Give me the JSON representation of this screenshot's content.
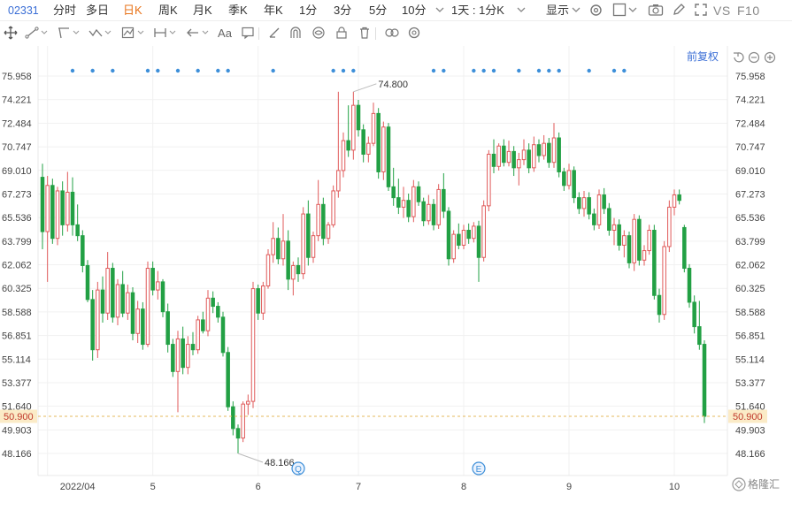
{
  "toolbar": {
    "code": "02331",
    "periods": [
      "分时",
      "多日",
      "日K",
      "周K",
      "月K",
      "季K",
      "年K",
      "1分",
      "3分",
      "5分",
      "10分"
    ],
    "active_period": "日K",
    "multi_period": "1天 : 1分K",
    "display_label": "显示",
    "vs_label": "VS",
    "f10_label": "F10"
  },
  "toolbar2": {
    "text_tool_label": "Aa"
  },
  "chart": {
    "adjust_label": "前复权",
    "high_label": "74.800",
    "low_label": "48.166",
    "current_price_label": "50.900",
    "marker_q": "Q",
    "marker_e": "E",
    "watermark": "格隆汇"
  },
  "chart_data": {
    "type": "candlestick",
    "ylim": [
      47.0,
      76.8
    ],
    "yticks": [
      "75.958",
      "74.221",
      "72.484",
      "70.747",
      "69.010",
      "67.273",
      "65.536",
      "63.799",
      "62.062",
      "60.325",
      "58.588",
      "56.851",
      "55.114",
      "53.377",
      "51.640",
      "49.903",
      "48.166"
    ],
    "xtick_labels": [
      "2022/04",
      "5",
      "6",
      "7",
      "8",
      "9",
      "10"
    ],
    "xtick_index": [
      1,
      22,
      43,
      63,
      84,
      105,
      126
    ],
    "current_price": 50.9,
    "max_price": 74.8,
    "max_index": 62,
    "min_price": 48.166,
    "min_index": 39,
    "dividend_dot_index": [
      6,
      10,
      14,
      21,
      23,
      27,
      31,
      35,
      37,
      46,
      58,
      60,
      62,
      78,
      80,
      86,
      88,
      90,
      95,
      99,
      101,
      103,
      109,
      114,
      116
    ],
    "event_markers": [
      {
        "label": "Q",
        "index": 51
      },
      {
        "label": "E",
        "index": 87
      }
    ],
    "candles": [
      {
        "o": 68.5,
        "h": 69.5,
        "l": 63.2,
        "c": 64.5
      },
      {
        "o": 64.5,
        "h": 68.6,
        "l": 60.8,
        "c": 67.9
      },
      {
        "o": 67.9,
        "h": 68.4,
        "l": 63.6,
        "c": 64.0
      },
      {
        "o": 64.0,
        "h": 67.8,
        "l": 63.5,
        "c": 67.5
      },
      {
        "o": 67.5,
        "h": 68.2,
        "l": 64.2,
        "c": 65.0
      },
      {
        "o": 65.0,
        "h": 68.9,
        "l": 64.5,
        "c": 67.4
      },
      {
        "o": 67.4,
        "h": 68.5,
        "l": 64.2,
        "c": 65.0
      },
      {
        "o": 65.0,
        "h": 66.5,
        "l": 63.8,
        "c": 64.2
      },
      {
        "o": 64.2,
        "h": 64.6,
        "l": 61.5,
        "c": 62.0
      },
      {
        "o": 62.0,
        "h": 62.4,
        "l": 59.3,
        "c": 59.5
      },
      {
        "o": 59.5,
        "h": 60.2,
        "l": 55.0,
        "c": 55.8
      },
      {
        "o": 55.8,
        "h": 60.8,
        "l": 55.2,
        "c": 60.2
      },
      {
        "o": 60.2,
        "h": 61.2,
        "l": 57.8,
        "c": 58.5
      },
      {
        "o": 58.5,
        "h": 63.0,
        "l": 58.0,
        "c": 61.8
      },
      {
        "o": 61.8,
        "h": 62.2,
        "l": 57.8,
        "c": 58.2
      },
      {
        "o": 58.2,
        "h": 61.0,
        "l": 57.6,
        "c": 60.6
      },
      {
        "o": 60.6,
        "h": 61.6,
        "l": 58.2,
        "c": 58.5
      },
      {
        "o": 58.5,
        "h": 60.6,
        "l": 58.0,
        "c": 60.0
      },
      {
        "o": 60.0,
        "h": 60.4,
        "l": 56.5,
        "c": 57.0
      },
      {
        "o": 57.0,
        "h": 59.4,
        "l": 56.3,
        "c": 58.8
      },
      {
        "o": 58.8,
        "h": 59.3,
        "l": 55.8,
        "c": 56.2
      },
      {
        "o": 56.2,
        "h": 62.3,
        "l": 56.0,
        "c": 61.8
      },
      {
        "o": 61.8,
        "h": 62.3,
        "l": 59.8,
        "c": 60.2
      },
      {
        "o": 60.2,
        "h": 61.6,
        "l": 59.5,
        "c": 60.8
      },
      {
        "o": 60.8,
        "h": 61.0,
        "l": 58.2,
        "c": 58.6
      },
      {
        "o": 58.6,
        "h": 59.2,
        "l": 55.6,
        "c": 56.2
      },
      {
        "o": 56.2,
        "h": 56.6,
        "l": 53.8,
        "c": 54.2
      },
      {
        "o": 54.2,
        "h": 57.2,
        "l": 51.2,
        "c": 56.6
      },
      {
        "o": 56.6,
        "h": 57.5,
        "l": 54.0,
        "c": 54.5
      },
      {
        "o": 54.5,
        "h": 56.8,
        "l": 54.0,
        "c": 56.2
      },
      {
        "o": 56.2,
        "h": 57.1,
        "l": 55.4,
        "c": 55.8
      },
      {
        "o": 55.8,
        "h": 58.3,
        "l": 55.5,
        "c": 58.0
      },
      {
        "o": 58.0,
        "h": 58.6,
        "l": 57.0,
        "c": 57.2
      },
      {
        "o": 57.2,
        "h": 60.2,
        "l": 56.8,
        "c": 59.6
      },
      {
        "o": 59.6,
        "h": 60.1,
        "l": 58.5,
        "c": 59.0
      },
      {
        "o": 59.0,
        "h": 59.3,
        "l": 57.8,
        "c": 58.2
      },
      {
        "o": 58.2,
        "h": 58.6,
        "l": 55.3,
        "c": 55.6
      },
      {
        "o": 55.6,
        "h": 56.0,
        "l": 51.3,
        "c": 51.6
      },
      {
        "o": 51.6,
        "h": 52.0,
        "l": 49.5,
        "c": 50.0
      },
      {
        "o": 50.0,
        "h": 50.3,
        "l": 48.166,
        "c": 49.3
      },
      {
        "o": 49.3,
        "h": 52.0,
        "l": 49.0,
        "c": 51.8
      },
      {
        "o": 51.8,
        "h": 52.5,
        "l": 51.0,
        "c": 52.0
      },
      {
        "o": 52.0,
        "h": 60.8,
        "l": 51.5,
        "c": 60.3
      },
      {
        "o": 60.3,
        "h": 60.6,
        "l": 58.0,
        "c": 58.5
      },
      {
        "o": 58.5,
        "h": 60.8,
        "l": 58.0,
        "c": 60.5
      },
      {
        "o": 60.5,
        "h": 63.2,
        "l": 60.3,
        "c": 62.8
      },
      {
        "o": 62.8,
        "h": 65.2,
        "l": 62.2,
        "c": 64.0
      },
      {
        "o": 64.0,
        "h": 64.8,
        "l": 62.1,
        "c": 62.5
      },
      {
        "o": 62.5,
        "h": 65.8,
        "l": 62.0,
        "c": 63.8
      },
      {
        "o": 63.8,
        "h": 64.6,
        "l": 60.2,
        "c": 61.0
      },
      {
        "o": 61.0,
        "h": 62.3,
        "l": 59.8,
        "c": 62.0
      },
      {
        "o": 62.0,
        "h": 62.6,
        "l": 60.8,
        "c": 61.4
      },
      {
        "o": 61.4,
        "h": 66.3,
        "l": 61.0,
        "c": 65.8
      },
      {
        "o": 65.8,
        "h": 66.8,
        "l": 62.0,
        "c": 62.6
      },
      {
        "o": 62.6,
        "h": 64.5,
        "l": 62.2,
        "c": 64.2
      },
      {
        "o": 64.2,
        "h": 68.3,
        "l": 63.8,
        "c": 66.5
      },
      {
        "o": 66.5,
        "h": 67.0,
        "l": 63.5,
        "c": 64.0
      },
      {
        "o": 64.0,
        "h": 65.2,
        "l": 63.6,
        "c": 65.0
      },
      {
        "o": 65.0,
        "h": 67.9,
        "l": 64.8,
        "c": 67.5
      },
      {
        "o": 67.5,
        "h": 74.8,
        "l": 67.0,
        "c": 69.0
      },
      {
        "o": 69.0,
        "h": 71.8,
        "l": 68.5,
        "c": 71.2
      },
      {
        "o": 71.2,
        "h": 73.8,
        "l": 70.0,
        "c": 70.5
      },
      {
        "o": 70.5,
        "h": 74.8,
        "l": 69.8,
        "c": 73.8
      },
      {
        "o": 73.8,
        "h": 74.2,
        "l": 71.5,
        "c": 72.0
      },
      {
        "o": 72.0,
        "h": 72.4,
        "l": 69.6,
        "c": 70.2
      },
      {
        "o": 70.2,
        "h": 71.5,
        "l": 69.6,
        "c": 71.0
      },
      {
        "o": 71.0,
        "h": 74.0,
        "l": 70.8,
        "c": 73.2
      },
      {
        "o": 73.2,
        "h": 73.6,
        "l": 68.4,
        "c": 68.9
      },
      {
        "o": 68.9,
        "h": 72.6,
        "l": 68.3,
        "c": 72.2
      },
      {
        "o": 72.2,
        "h": 72.5,
        "l": 67.5,
        "c": 67.8
      },
      {
        "o": 67.8,
        "h": 69.2,
        "l": 66.4,
        "c": 67.0
      },
      {
        "o": 67.0,
        "h": 68.4,
        "l": 65.8,
        "c": 66.3
      },
      {
        "o": 66.3,
        "h": 67.8,
        "l": 65.5,
        "c": 66.8
      },
      {
        "o": 66.8,
        "h": 67.3,
        "l": 65.2,
        "c": 65.6
      },
      {
        "o": 65.6,
        "h": 68.3,
        "l": 65.2,
        "c": 67.8
      },
      {
        "o": 67.8,
        "h": 68.2,
        "l": 66.4,
        "c": 66.7
      },
      {
        "o": 66.7,
        "h": 67.0,
        "l": 64.9,
        "c": 65.3
      },
      {
        "o": 65.3,
        "h": 67.2,
        "l": 65.0,
        "c": 66.5
      },
      {
        "o": 66.5,
        "h": 66.9,
        "l": 64.6,
        "c": 65.0
      },
      {
        "o": 65.0,
        "h": 68.0,
        "l": 64.7,
        "c": 67.6
      },
      {
        "o": 67.6,
        "h": 68.8,
        "l": 65.5,
        "c": 66.0
      },
      {
        "o": 66.0,
        "h": 66.3,
        "l": 62.0,
        "c": 62.5
      },
      {
        "o": 62.5,
        "h": 64.6,
        "l": 62.2,
        "c": 64.3
      },
      {
        "o": 64.3,
        "h": 65.1,
        "l": 63.2,
        "c": 63.5
      },
      {
        "o": 63.5,
        "h": 65.0,
        "l": 63.2,
        "c": 64.6
      },
      {
        "o": 64.6,
        "h": 65.1,
        "l": 63.6,
        "c": 64.0
      },
      {
        "o": 64.0,
        "h": 65.2,
        "l": 63.7,
        "c": 64.9
      },
      {
        "o": 64.9,
        "h": 65.3,
        "l": 60.8,
        "c": 62.6
      },
      {
        "o": 62.6,
        "h": 66.8,
        "l": 62.3,
        "c": 66.4
      },
      {
        "o": 66.4,
        "h": 70.5,
        "l": 66.0,
        "c": 70.2
      },
      {
        "o": 70.2,
        "h": 71.3,
        "l": 68.8,
        "c": 69.3
      },
      {
        "o": 69.3,
        "h": 71.0,
        "l": 69.0,
        "c": 70.8
      },
      {
        "o": 70.8,
        "h": 71.3,
        "l": 69.3,
        "c": 69.6
      },
      {
        "o": 69.6,
        "h": 71.2,
        "l": 69.3,
        "c": 70.4
      },
      {
        "o": 70.4,
        "h": 70.8,
        "l": 68.6,
        "c": 69.2
      },
      {
        "o": 69.2,
        "h": 70.3,
        "l": 67.9,
        "c": 69.8
      },
      {
        "o": 69.8,
        "h": 71.3,
        "l": 69.4,
        "c": 70.5
      },
      {
        "o": 70.5,
        "h": 71.0,
        "l": 68.8,
        "c": 69.2
      },
      {
        "o": 69.2,
        "h": 71.5,
        "l": 68.9,
        "c": 70.9
      },
      {
        "o": 70.9,
        "h": 71.3,
        "l": 69.6,
        "c": 70.1
      },
      {
        "o": 70.1,
        "h": 71.6,
        "l": 69.8,
        "c": 71.0
      },
      {
        "o": 71.0,
        "h": 71.4,
        "l": 69.2,
        "c": 69.6
      },
      {
        "o": 69.6,
        "h": 72.5,
        "l": 69.2,
        "c": 71.4
      },
      {
        "o": 71.4,
        "h": 71.8,
        "l": 68.5,
        "c": 68.9
      },
      {
        "o": 68.9,
        "h": 69.2,
        "l": 67.5,
        "c": 67.9
      },
      {
        "o": 67.9,
        "h": 69.5,
        "l": 67.6,
        "c": 69.0
      },
      {
        "o": 69.0,
        "h": 69.3,
        "l": 66.6,
        "c": 67.0
      },
      {
        "o": 67.0,
        "h": 67.4,
        "l": 65.8,
        "c": 66.2
      },
      {
        "o": 66.2,
        "h": 67.5,
        "l": 65.6,
        "c": 67.0
      },
      {
        "o": 67.0,
        "h": 67.4,
        "l": 65.4,
        "c": 65.8
      },
      {
        "o": 65.8,
        "h": 66.2,
        "l": 64.6,
        "c": 65.0
      },
      {
        "o": 65.0,
        "h": 67.6,
        "l": 64.7,
        "c": 67.2
      },
      {
        "o": 67.2,
        "h": 67.7,
        "l": 65.8,
        "c": 66.2
      },
      {
        "o": 66.2,
        "h": 66.6,
        "l": 64.2,
        "c": 64.6
      },
      {
        "o": 64.6,
        "h": 65.5,
        "l": 63.5,
        "c": 65.0
      },
      {
        "o": 65.0,
        "h": 65.4,
        "l": 63.1,
        "c": 63.5
      },
      {
        "o": 63.5,
        "h": 64.6,
        "l": 62.6,
        "c": 64.2
      },
      {
        "o": 64.2,
        "h": 64.5,
        "l": 61.8,
        "c": 62.2
      },
      {
        "o": 62.2,
        "h": 65.8,
        "l": 61.6,
        "c": 65.4
      },
      {
        "o": 65.4,
        "h": 65.7,
        "l": 62.0,
        "c": 62.4
      },
      {
        "o": 62.4,
        "h": 63.5,
        "l": 62.0,
        "c": 63.1
      },
      {
        "o": 63.1,
        "h": 65.0,
        "l": 62.8,
        "c": 64.6
      },
      {
        "o": 64.6,
        "h": 65.0,
        "l": 59.5,
        "c": 59.8
      },
      {
        "o": 59.8,
        "h": 60.3,
        "l": 57.8,
        "c": 58.4
      },
      {
        "o": 58.4,
        "h": 63.8,
        "l": 58.0,
        "c": 63.4
      },
      {
        "o": 63.4,
        "h": 66.8,
        "l": 63.0,
        "c": 66.3
      },
      {
        "o": 66.3,
        "h": 67.6,
        "l": 65.7,
        "c": 67.2
      },
      {
        "o": 67.2,
        "h": 67.6,
        "l": 66.5,
        "c": 66.8
      },
      {
        "o": 64.8,
        "h": 65.0,
        "l": 61.5,
        "c": 61.8
      },
      {
        "o": 61.8,
        "h": 62.1,
        "l": 58.9,
        "c": 59.3
      },
      {
        "o": 59.3,
        "h": 59.8,
        "l": 57.0,
        "c": 57.5
      },
      {
        "o": 57.5,
        "h": 59.4,
        "l": 55.8,
        "c": 56.2
      },
      {
        "o": 56.2,
        "h": 56.5,
        "l": 50.4,
        "c": 50.9
      }
    ]
  }
}
